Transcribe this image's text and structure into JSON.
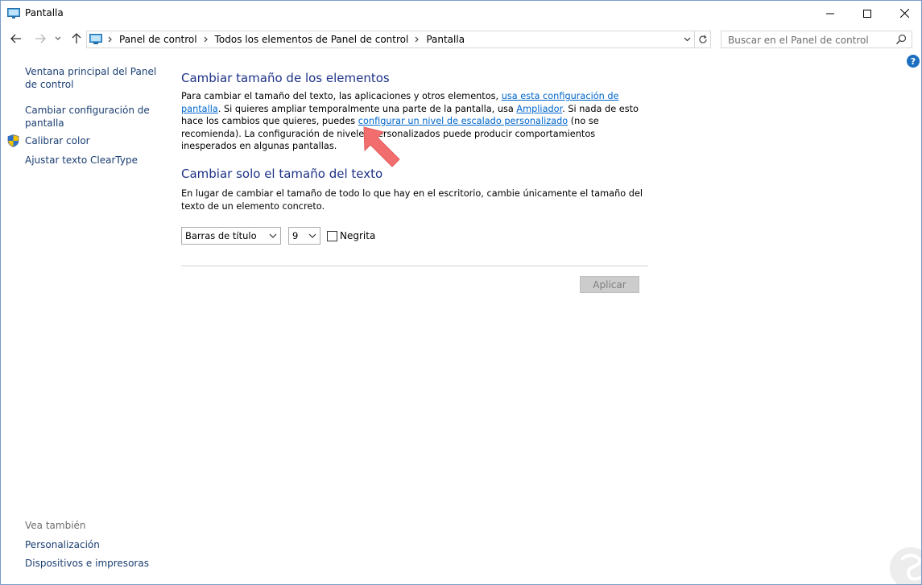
{
  "window": {
    "title": "Pantalla"
  },
  "address": {
    "crumbs": [
      "Panel de control",
      "Todos los elementos de Panel de control",
      "Pantalla"
    ]
  },
  "search": {
    "placeholder": "Buscar en el Panel de control"
  },
  "help": {
    "label": "?"
  },
  "sidebar": {
    "links": [
      {
        "label": "Ventana principal del Panel de control"
      },
      {
        "label": "Cambiar configuración de pantalla"
      },
      {
        "label": "Calibrar color",
        "icon": "uac-shield-icon"
      },
      {
        "label": "Ajustar texto ClearType"
      }
    ],
    "see_also": {
      "heading": "Vea también",
      "links": [
        {
          "label": "Personalización"
        },
        {
          "label": "Dispositivos e impresoras"
        }
      ]
    }
  },
  "main": {
    "section1": {
      "heading": "Cambiar tamaño de los elementos",
      "text1": "Para cambiar el tamaño del texto, las aplicaciones y otros elementos, ",
      "link1": "usa esta configuración de pantalla",
      "text2": ". Si quieres ampliar temporalmente una parte de la pantalla, usa ",
      "link2": "Ampliador",
      "text3": ". Si nada de esto hace los cambios que quieres, puedes ",
      "link3": "configurar un nivel de escalado personalizado",
      "text4": " (no se recomienda). La configuración de niveles personalizados puede producir comportamientos inesperados en algunas pantallas."
    },
    "section2": {
      "heading": "Cambiar solo el tamaño del texto",
      "text": "En lugar de cambiar el tamaño de todo lo que hay en el escritorio, cambie únicamente el tamaño del texto de un elemento concreto.",
      "element_select": "Barras de título",
      "size_select": "9",
      "bold_label": "Negrita",
      "bold_checked": false
    },
    "apply_label": "Aplicar"
  },
  "colors": {
    "heading": "#1e3287",
    "link": "#0066cc",
    "sidebar_link": "#1a3e72",
    "annotation_arrow": "#f26d6d"
  }
}
